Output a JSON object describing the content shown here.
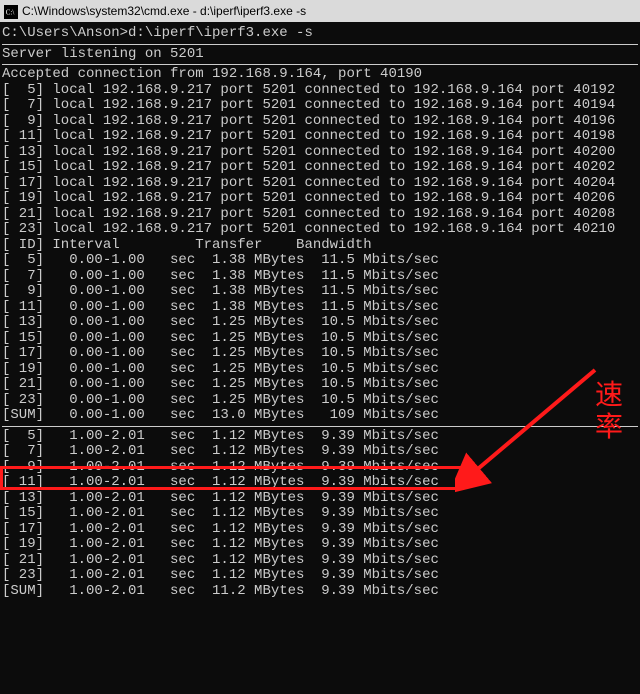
{
  "window": {
    "title": "C:\\Windows\\system32\\cmd.exe - d:\\iperf\\iperf3.exe  -s"
  },
  "prompt": "C:\\Users\\Anson>d:\\iperf\\iperf3.exe -s",
  "listen": "Server listening on 5201",
  "accept": "Accepted connection from 192.168.9.164, port 40190",
  "conn": [
    {
      "id": "5",
      "local": "192.168.9.217",
      "lport": "5201",
      "remote": "192.168.9.164",
      "rport": "40192"
    },
    {
      "id": "7",
      "local": "192.168.9.217",
      "lport": "5201",
      "remote": "192.168.9.164",
      "rport": "40194"
    },
    {
      "id": "9",
      "local": "192.168.9.217",
      "lport": "5201",
      "remote": "192.168.9.164",
      "rport": "40196"
    },
    {
      "id": "11",
      "local": "192.168.9.217",
      "lport": "5201",
      "remote": "192.168.9.164",
      "rport": "40198"
    },
    {
      "id": "13",
      "local": "192.168.9.217",
      "lport": "5201",
      "remote": "192.168.9.164",
      "rport": "40200"
    },
    {
      "id": "15",
      "local": "192.168.9.217",
      "lport": "5201",
      "remote": "192.168.9.164",
      "rport": "40202"
    },
    {
      "id": "17",
      "local": "192.168.9.217",
      "lport": "5201",
      "remote": "192.168.9.164",
      "rport": "40204"
    },
    {
      "id": "19",
      "local": "192.168.9.217",
      "lport": "5201",
      "remote": "192.168.9.164",
      "rport": "40206"
    },
    {
      "id": "21",
      "local": "192.168.9.217",
      "lport": "5201",
      "remote": "192.168.9.164",
      "rport": "40208"
    },
    {
      "id": "23",
      "local": "192.168.9.217",
      "lport": "5201",
      "remote": "192.168.9.164",
      "rport": "40210"
    }
  ],
  "head": {
    "id": "ID",
    "interval": "Interval",
    "transfer": "Transfer",
    "bw": "Bandwidth"
  },
  "b1": [
    {
      "id": "5",
      "iv": "0.00-1.00",
      "u": "sec",
      "xf": "1.38 MBytes",
      "bw": "11.5 Mbits/sec"
    },
    {
      "id": "7",
      "iv": "0.00-1.00",
      "u": "sec",
      "xf": "1.38 MBytes",
      "bw": "11.5 Mbits/sec"
    },
    {
      "id": "9",
      "iv": "0.00-1.00",
      "u": "sec",
      "xf": "1.38 MBytes",
      "bw": "11.5 Mbits/sec"
    },
    {
      "id": "11",
      "iv": "0.00-1.00",
      "u": "sec",
      "xf": "1.38 MBytes",
      "bw": "11.5 Mbits/sec"
    },
    {
      "id": "13",
      "iv": "0.00-1.00",
      "u": "sec",
      "xf": "1.25 MBytes",
      "bw": "10.5 Mbits/sec"
    },
    {
      "id": "15",
      "iv": "0.00-1.00",
      "u": "sec",
      "xf": "1.25 MBytes",
      "bw": "10.5 Mbits/sec"
    },
    {
      "id": "17",
      "iv": "0.00-1.00",
      "u": "sec",
      "xf": "1.25 MBytes",
      "bw": "10.5 Mbits/sec"
    },
    {
      "id": "19",
      "iv": "0.00-1.00",
      "u": "sec",
      "xf": "1.25 MBytes",
      "bw": "10.5 Mbits/sec"
    },
    {
      "id": "21",
      "iv": "0.00-1.00",
      "u": "sec",
      "xf": "1.25 MBytes",
      "bw": "10.5 Mbits/sec"
    },
    {
      "id": "23",
      "iv": "0.00-1.00",
      "u": "sec",
      "xf": "1.25 MBytes",
      "bw": "10.5 Mbits/sec"
    }
  ],
  "sum1": {
    "id": "SUM",
    "iv": "0.00-1.00",
    "u": "sec",
    "xf": "13.0 MBytes",
    "bw": " 109 Mbits/sec"
  },
  "b2": [
    {
      "id": "5",
      "iv": "1.00-2.01",
      "u": "sec",
      "xf": "1.12 MBytes",
      "bw": "9.39 Mbits/sec"
    },
    {
      "id": "7",
      "iv": "1.00-2.01",
      "u": "sec",
      "xf": "1.12 MBytes",
      "bw": "9.39 Mbits/sec"
    },
    {
      "id": "9",
      "iv": "1.00-2.01",
      "u": "sec",
      "xf": "1.12 MBytes",
      "bw": "9.39 Mbits/sec"
    },
    {
      "id": "11",
      "iv": "1.00-2.01",
      "u": "sec",
      "xf": "1.12 MBytes",
      "bw": "9.39 Mbits/sec"
    },
    {
      "id": "13",
      "iv": "1.00-2.01",
      "u": "sec",
      "xf": "1.12 MBytes",
      "bw": "9.39 Mbits/sec"
    },
    {
      "id": "15",
      "iv": "1.00-2.01",
      "u": "sec",
      "xf": "1.12 MBytes",
      "bw": "9.39 Mbits/sec"
    },
    {
      "id": "17",
      "iv": "1.00-2.01",
      "u": "sec",
      "xf": "1.12 MBytes",
      "bw": "9.39 Mbits/sec"
    },
    {
      "id": "19",
      "iv": "1.00-2.01",
      "u": "sec",
      "xf": "1.12 MBytes",
      "bw": "9.39 Mbits/sec"
    },
    {
      "id": "21",
      "iv": "1.00-2.01",
      "u": "sec",
      "xf": "1.12 MBytes",
      "bw": "9.39 Mbits/sec"
    },
    {
      "id": "23",
      "iv": "1.00-2.01",
      "u": "sec",
      "xf": "1.12 MBytes",
      "bw": "9.39 Mbits/sec"
    }
  ],
  "sum2": {
    "id": "SUM",
    "iv": "1.00-2.01",
    "u": "sec",
    "xf": "11.2 MBytes",
    "bw": "9.39 Mbits/sec"
  },
  "annotation": "速\n率"
}
